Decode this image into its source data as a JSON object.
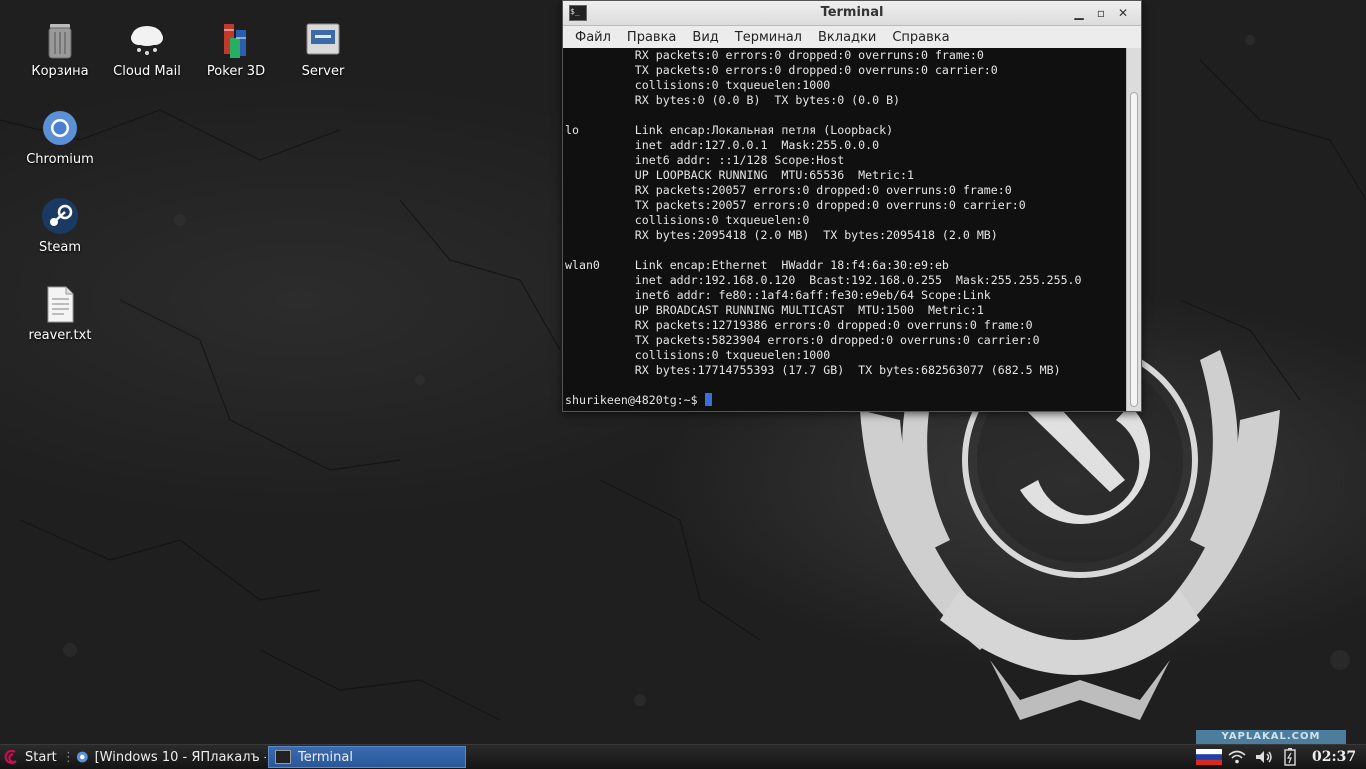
{
  "desktop": {
    "icons": [
      {
        "label": "Корзина"
      },
      {
        "label": "Cloud Mail"
      },
      {
        "label": "Poker 3D"
      },
      {
        "label": "Server"
      },
      {
        "label": "Chromium"
      },
      {
        "label": "Steam"
      },
      {
        "label": "reaver.txt"
      }
    ]
  },
  "terminal": {
    "title": "Terminal",
    "menu": [
      "Файл",
      "Правка",
      "Вид",
      "Терминал",
      "Вкладки",
      "Справка"
    ],
    "lines": [
      "          RX packets:0 errors:0 dropped:0 overruns:0 frame:0",
      "          TX packets:0 errors:0 dropped:0 overruns:0 carrier:0",
      "          collisions:0 txqueuelen:1000",
      "          RX bytes:0 (0.0 B)  TX bytes:0 (0.0 B)",
      "",
      "lo        Link encap:Локальная петля (Loopback)",
      "          inet addr:127.0.0.1  Mask:255.0.0.0",
      "          inet6 addr: ::1/128 Scope:Host",
      "          UP LOOPBACK RUNNING  MTU:65536  Metric:1",
      "          RX packets:20057 errors:0 dropped:0 overruns:0 frame:0",
      "          TX packets:20057 errors:0 dropped:0 overruns:0 carrier:0",
      "          collisions:0 txqueuelen:0",
      "          RX bytes:2095418 (2.0 MB)  TX bytes:2095418 (2.0 MB)",
      "",
      "wlan0     Link encap:Ethernet  HWaddr 18:f4:6a:30:e9:eb",
      "          inet addr:192.168.0.120  Bcast:192.168.0.255  Mask:255.255.255.0",
      "          inet6 addr: fe80::1af4:6aff:fe30:e9eb/64 Scope:Link",
      "          UP BROADCAST RUNNING MULTICAST  MTU:1500  Metric:1",
      "          RX packets:12719386 errors:0 dropped:0 overruns:0 frame:0",
      "          TX packets:5823904 errors:0 dropped:0 overruns:0 carrier:0",
      "          collisions:0 txqueuelen:1000",
      "          RX bytes:17714755393 (17.7 GB)  TX bytes:682563077 (682.5 MB)",
      ""
    ],
    "prompt": "shurikeen@4820tg:~$ "
  },
  "taskbar": {
    "start_label": "Start",
    "tasks": [
      {
        "label": "[Windows 10 - ЯПлакалъ - ..."
      },
      {
        "label": "Terminal"
      }
    ],
    "clock": "02:37",
    "watermark": "YAPLAKAL.COM"
  },
  "colors": {
    "taskbar_active": "#2f62a8",
    "cursor": "#3a6fd8"
  }
}
